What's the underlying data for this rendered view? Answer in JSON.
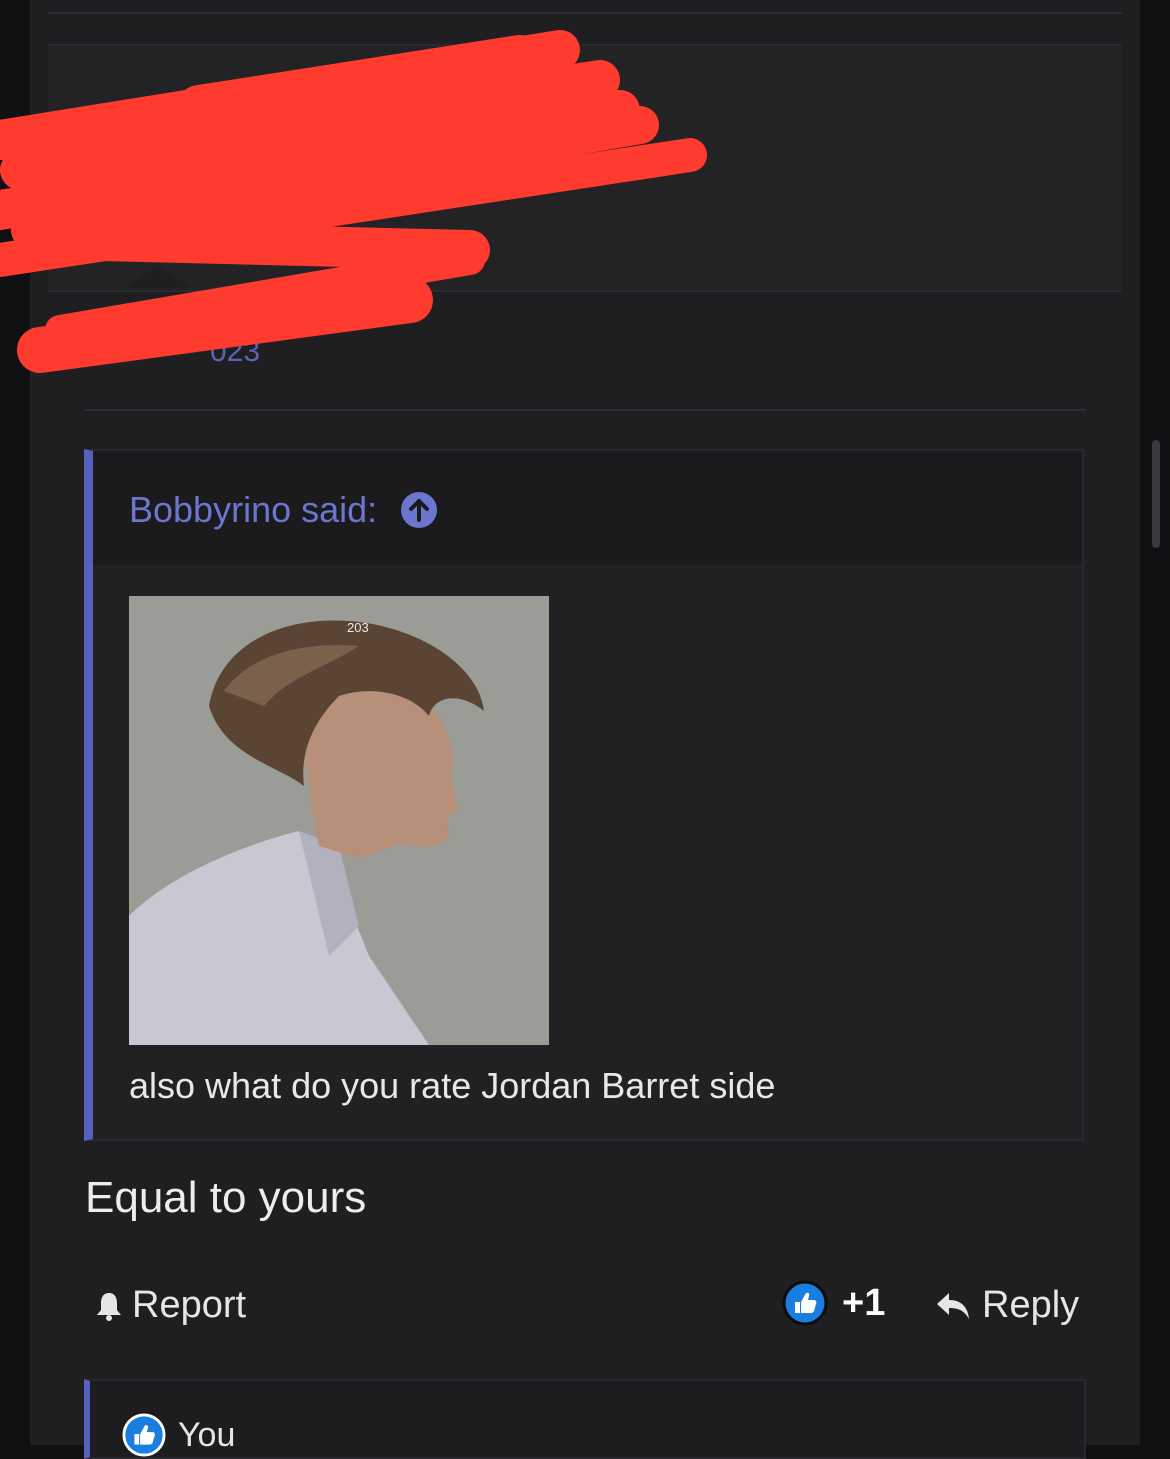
{
  "quote": {
    "author": "Bobbyrino said:",
    "photo_caption": "203",
    "text": "also what do you rate Jordan Barret side"
  },
  "reply": {
    "text": "Equal to yours"
  },
  "actions": {
    "report_label": "Report",
    "like_count": "+1",
    "reply_label": "Reply"
  },
  "reactions": {
    "user": "You"
  },
  "icons": {
    "quote_jump": "arrow-up-circle-icon",
    "report": "bell-icon",
    "like": "thumbs-up-icon",
    "reply": "reply-arrow-icon"
  },
  "colors": {
    "accent": "#5560c0",
    "link": "#6c76cf",
    "like_badge": "#1a7de0",
    "redaction": "#ff3b30"
  }
}
